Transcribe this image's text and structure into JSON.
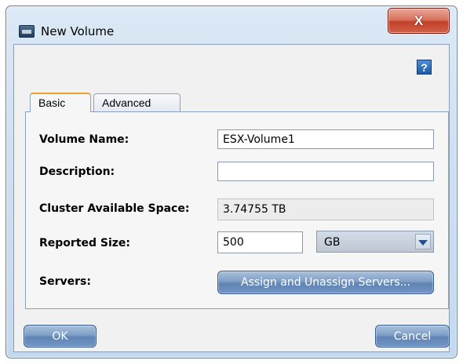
{
  "window": {
    "title": "New Volume",
    "close_label": "X",
    "help_label": "?"
  },
  "tabs": [
    {
      "label": "Basic",
      "selected": true
    },
    {
      "label": "Advanced",
      "selected": false
    }
  ],
  "form": {
    "volume_name": {
      "label": "Volume Name:",
      "value": "ESX-Volume1"
    },
    "description": {
      "label": "Description:",
      "value": ""
    },
    "cluster_space": {
      "label": "Cluster Available Space:",
      "value": "3.74755 TB"
    },
    "reported_size": {
      "label": "Reported Size:",
      "value": "500",
      "unit": "GB"
    },
    "servers": {
      "label": "Servers:",
      "button_label": "Assign and Unassign Servers..."
    }
  },
  "footer": {
    "ok_label": "OK",
    "cancel_label": "Cancel"
  },
  "colors": {
    "close_button": "#c9533d",
    "button_blue": "#7396c3",
    "active_tab_accent": "#f0a12a"
  }
}
